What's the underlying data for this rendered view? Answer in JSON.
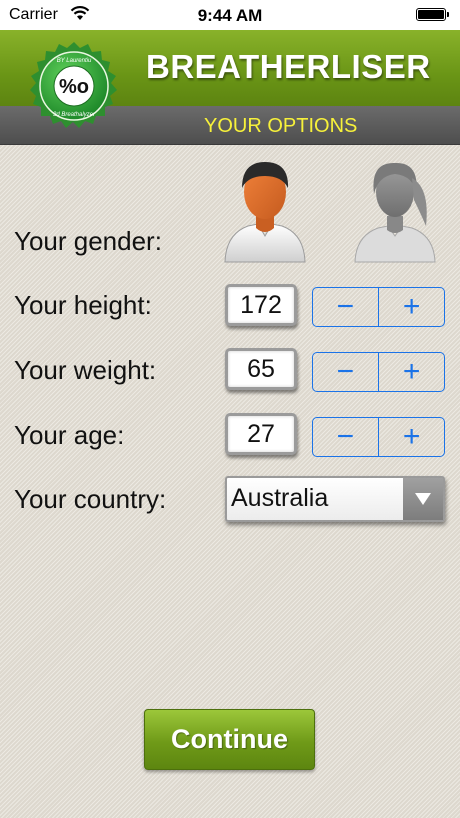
{
  "status_bar": {
    "carrier": "Carrier",
    "time": "9:44 AM",
    "battery_level": 1.0
  },
  "header": {
    "title": "BREATHERLISER",
    "subtitle": "YOUR OPTIONS",
    "logo_symbol": "%o",
    "logo_top_text": "BY Laurentiu",
    "logo_bottom_text": "3d Breathalyzer"
  },
  "form": {
    "gender_label": "Your gender:",
    "gender_options": [
      "male",
      "female"
    ],
    "gender_selected": "male",
    "height_label": "Your height:",
    "height_value": "172",
    "weight_label": "Your weight:",
    "weight_value": "65",
    "age_label": "Your age:",
    "age_value": "27",
    "country_label": "Your country:",
    "country_value": "Australia",
    "stepper_minus": "−",
    "stepper_plus": "+"
  },
  "continue_label": "Continue",
  "colors": {
    "header_green": "#6a9516",
    "subheader_gray": "#555555",
    "subtitle_yellow": "#f7f13a",
    "stepper_blue": "#1b73e8",
    "button_green": "#7aa620"
  },
  "icons": {
    "wifi": "wifi-icon",
    "battery": "battery-icon",
    "male_avatar": "male-avatar-icon",
    "female_avatar": "female-avatar-icon",
    "dropdown": "chevron-down-icon"
  }
}
